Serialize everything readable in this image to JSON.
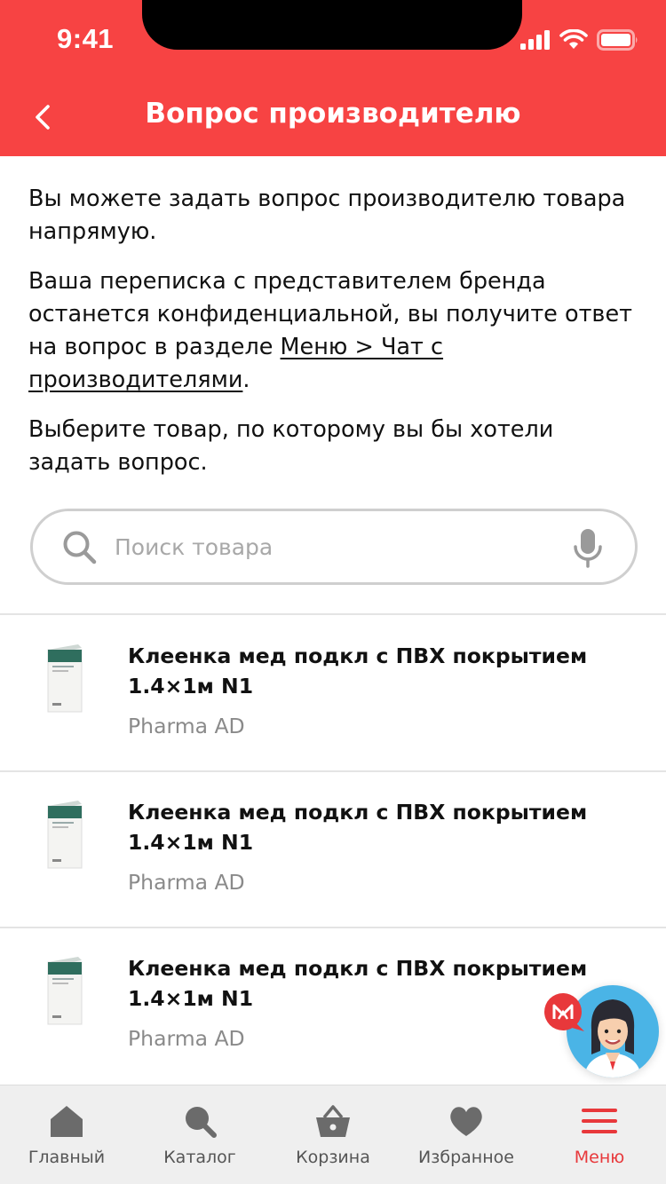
{
  "status_bar": {
    "time": "9:41"
  },
  "header": {
    "title": "Вопрос производителю",
    "accent": "#f74343"
  },
  "intro": {
    "p1": "Вы можете задать вопрос производителю товара напрямую.",
    "p2_before": "Ваша переписка с представителем бренда останется конфиденциальной, вы получите ответ на вопрос в разделе ",
    "p2_link": "Меню > Чат с производителями",
    "p2_after": ".",
    "p3": "Выберите товар, по которому вы бы хотели задать вопрос."
  },
  "search": {
    "placeholder": "Поиск товара",
    "value": ""
  },
  "products": [
    {
      "name": "Клеенка мед подкл с ПВХ покрытием 1.4×1м N1",
      "brand": "Pharma AD"
    },
    {
      "name": "Клеенка мед подкл с ПВХ покрытием 1.4×1м N1",
      "brand": "Pharma AD"
    },
    {
      "name": "Клеенка мед подкл с ПВХ покрытием 1.4×1м N1",
      "brand": "Pharma AD"
    }
  ],
  "tabs": [
    {
      "label": "Главный",
      "icon": "home-icon"
    },
    {
      "label": "Каталог",
      "icon": "search-icon"
    },
    {
      "label": "Корзина",
      "icon": "basket-icon"
    },
    {
      "label": "Избранное",
      "icon": "heart-icon"
    },
    {
      "label": "Меню",
      "icon": "menu-icon",
      "active": true,
      "active_color": "#e8383b"
    }
  ]
}
